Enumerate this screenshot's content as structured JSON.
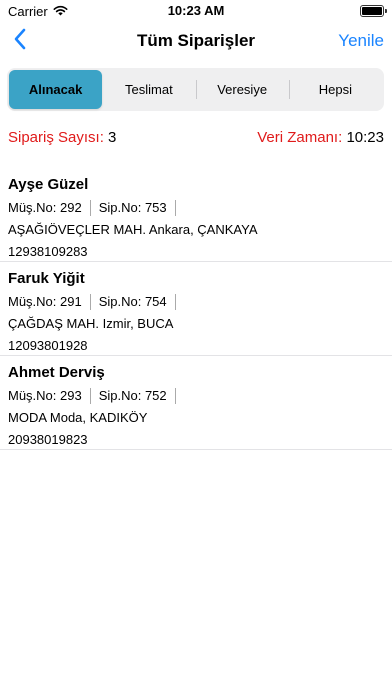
{
  "status_bar": {
    "carrier": "Carrier",
    "time": "10:23 AM"
  },
  "nav": {
    "title": "Tüm Siparişler",
    "refresh_label": "Yenile",
    "back_icon": "chevron-left-icon"
  },
  "tabs": [
    {
      "label": "Alınacak",
      "active": true
    },
    {
      "label": "Teslimat",
      "active": false
    },
    {
      "label": "Veresiye",
      "active": false
    },
    {
      "label": "Hepsi",
      "active": false
    }
  ],
  "info": {
    "order_count_label": "Sipariş Sayısı:",
    "order_count": "3",
    "data_time_label": "Veri Zamanı:",
    "data_time": "10:23"
  },
  "orders": [
    {
      "name": "Ayşe Güzel",
      "customer_no": "Müş.No: 292",
      "order_no": "Sip.No: 753",
      "address": "AŞAĞIÖVEÇLER MAH. Ankara, ÇANKAYA",
      "phone": "12938109283"
    },
    {
      "name": "Faruk Yiğit",
      "customer_no": "Müş.No: 291",
      "order_no": "Sip.No: 754",
      "address": "ÇAĞDAŞ MAH. Izmir, BUCA",
      "phone": "12093801928"
    },
    {
      "name": "Ahmet Derviş",
      "customer_no": "Müş.No: 293",
      "order_no": "Sip.No: 752",
      "address": "MODA Moda, KADIKÖY",
      "phone": "20938019823"
    }
  ],
  "colors": {
    "accent": "#1a84ff",
    "active_tab": "#3ba3c6",
    "label_red": "#e01b1b"
  }
}
